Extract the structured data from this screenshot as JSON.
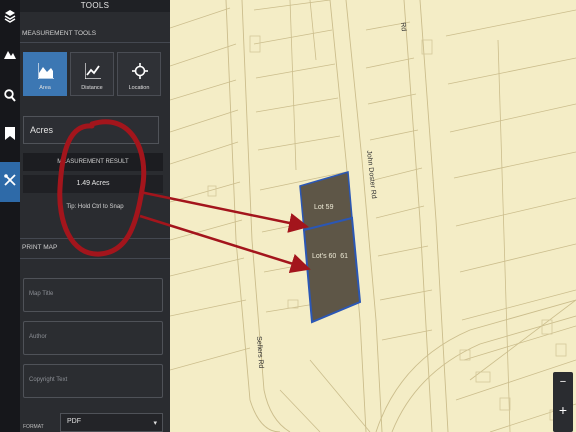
{
  "panel": {
    "title": "TOOLS",
    "measurement_section": "MEASUREMENT TOOLS",
    "tools": [
      {
        "label": "Area",
        "icon": "area-chart-icon",
        "active": true
      },
      {
        "label": "Distance",
        "icon": "line-chart-icon",
        "active": false
      },
      {
        "label": "Location",
        "icon": "crosshair-icon",
        "active": false
      }
    ],
    "unit": "Acres",
    "result_header": "MEASUREMENT RESULT",
    "result_value": "1.49 Acres",
    "tip": "Tip: Hold Ctrl to Snap",
    "print_section": "PRINT MAP",
    "map_title_placeholder": "Map Title",
    "author_placeholder": "Author",
    "copyright_placeholder": "Copyright Text",
    "format_label": "FORMAT",
    "format_value": "PDF"
  },
  "rail": {
    "icons": [
      "layers-icon",
      "mountain-icon",
      "search-icon",
      "bookmark-icon",
      "tools-icon"
    ],
    "active": "tools-icon"
  },
  "map": {
    "lots": [
      {
        "label": "Lot 59"
      },
      {
        "label": "Lot's 60  61"
      }
    ],
    "roads": [
      "John Doster Rd",
      "Sellers Rd",
      "Rd"
    ],
    "zoom": {
      "out": "−",
      "in": "+"
    }
  },
  "colors": {
    "map_bg": "#f4edc6",
    "parcel_line": "#c9b98a",
    "lot_fill": "#5e5647",
    "lot_outline": "#2b57b5",
    "annotation": "#a3151c",
    "panel_bg": "#2a2c30",
    "active_tool": "#3c77b3"
  }
}
